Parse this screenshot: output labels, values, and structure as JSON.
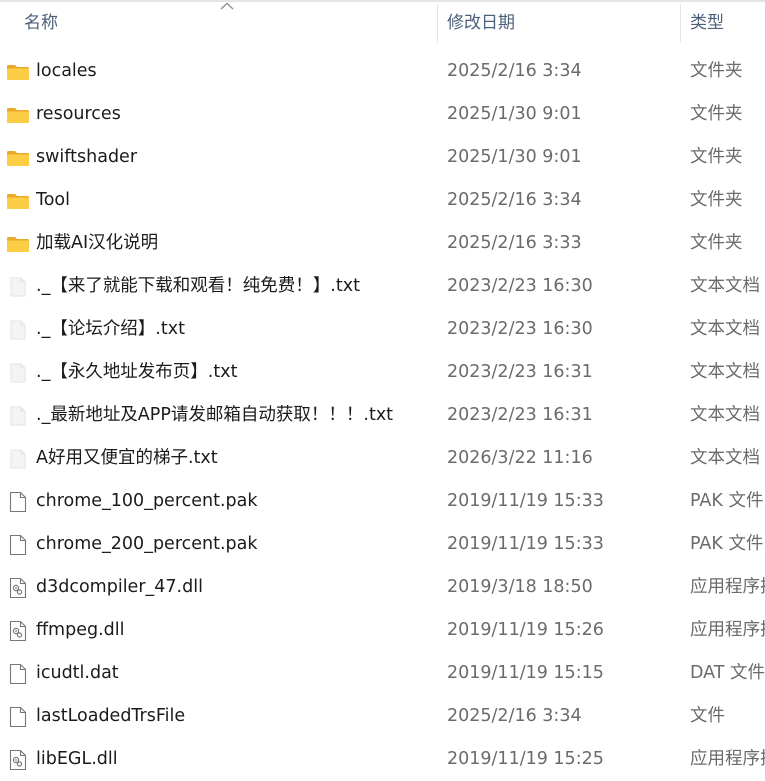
{
  "columns": {
    "name": "名称",
    "date": "修改日期",
    "type": "类型"
  },
  "files": [
    {
      "name": "locales",
      "date": "2025/2/16 3:34",
      "type": "文件夹",
      "icon": "folder-icon"
    },
    {
      "name": "resources",
      "date": "2025/1/30 9:01",
      "type": "文件夹",
      "icon": "folder-icon"
    },
    {
      "name": "swiftshader",
      "date": "2025/1/30 9:01",
      "type": "文件夹",
      "icon": "folder-icon"
    },
    {
      "name": "Tool",
      "date": "2025/2/16 3:34",
      "type": "文件夹",
      "icon": "folder-icon"
    },
    {
      "name": "加载AI汉化说明",
      "date": "2025/2/16 3:33",
      "type": "文件夹",
      "icon": "folder-icon"
    },
    {
      "name": "._【来了就能下载和观看！纯免费！】.txt",
      "date": "2023/2/23 16:30",
      "type": "文本文档",
      "icon": "text-file-icon"
    },
    {
      "name": "._【论坛介绍】.txt",
      "date": "2023/2/23 16:30",
      "type": "文本文档",
      "icon": "text-file-icon"
    },
    {
      "name": "._【永久地址发布页】.txt",
      "date": "2023/2/23 16:31",
      "type": "文本文档",
      "icon": "text-file-icon"
    },
    {
      "name": "._最新地址及APP请发邮箱自动获取！！！.txt",
      "date": "2023/2/23 16:31",
      "type": "文本文档",
      "icon": "text-file-icon"
    },
    {
      "name": "A好用又便宜的梯子.txt",
      "date": "2026/3/22 11:16",
      "type": "文本文档",
      "icon": "text-file-icon"
    },
    {
      "name": "chrome_100_percent.pak",
      "date": "2019/11/19 15:33",
      "type": "PAK 文件",
      "icon": "file-icon"
    },
    {
      "name": "chrome_200_percent.pak",
      "date": "2019/11/19 15:33",
      "type": "PAK 文件",
      "icon": "file-icon"
    },
    {
      "name": "d3dcompiler_47.dll",
      "date": "2019/3/18 18:50",
      "type": "应用程序扩展",
      "icon": "dll-icon"
    },
    {
      "name": "ffmpeg.dll",
      "date": "2019/11/19 15:26",
      "type": "应用程序扩展",
      "icon": "dll-icon"
    },
    {
      "name": "icudtl.dat",
      "date": "2019/11/19 15:15",
      "type": "DAT 文件",
      "icon": "file-icon"
    },
    {
      "name": "lastLoadedTrsFile",
      "date": "2025/2/16 3:34",
      "type": "文件",
      "icon": "file-icon"
    },
    {
      "name": "libEGL.dll",
      "date": "2019/11/19 15:25",
      "type": "应用程序扩展",
      "icon": "dll-icon"
    }
  ],
  "colors": {
    "folder": "#f8c93f",
    "header_text": "#4c607a"
  }
}
